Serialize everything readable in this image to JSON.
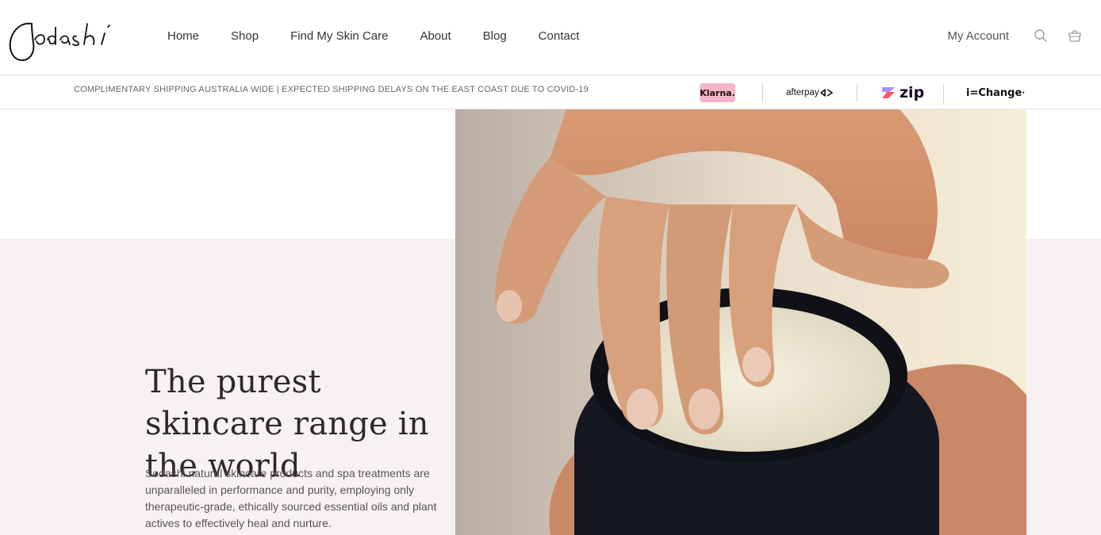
{
  "brand": {
    "name": "Sodashi"
  },
  "nav": {
    "items": [
      {
        "label": "Home"
      },
      {
        "label": "Shop"
      },
      {
        "label": "Find My Skin Care"
      },
      {
        "label": "About"
      },
      {
        "label": "Blog"
      },
      {
        "label": "Contact"
      }
    ]
  },
  "header": {
    "account_label": "My Account",
    "icons": [
      "search-icon",
      "basket-icon"
    ]
  },
  "infobar": {
    "text": "COMPLIMENTARY SHIPPING AUSTRALIA WIDE | EXPECTED SHIPPING DELAYS ON THE EAST COAST DUE TO COVID-19",
    "payments": {
      "klarna": "Klarna.",
      "afterpay": "afterpay",
      "zip": "zip",
      "ichange": "i=Change"
    }
  },
  "hero": {
    "title": "The purest skincare range in the world",
    "description": "Sodashi natural skincare products and spa treatments are unparalleled in performance and purity, employing only therapeutic-grade, ethically sourced essential oils and plant actives to effectively heal and nurture."
  },
  "colors": {
    "hero_bg": "#f7f1f2",
    "klarna_pink": "#f5b5c8",
    "zip_purple": "#1a0826",
    "text_dark": "#2b2b2b"
  }
}
